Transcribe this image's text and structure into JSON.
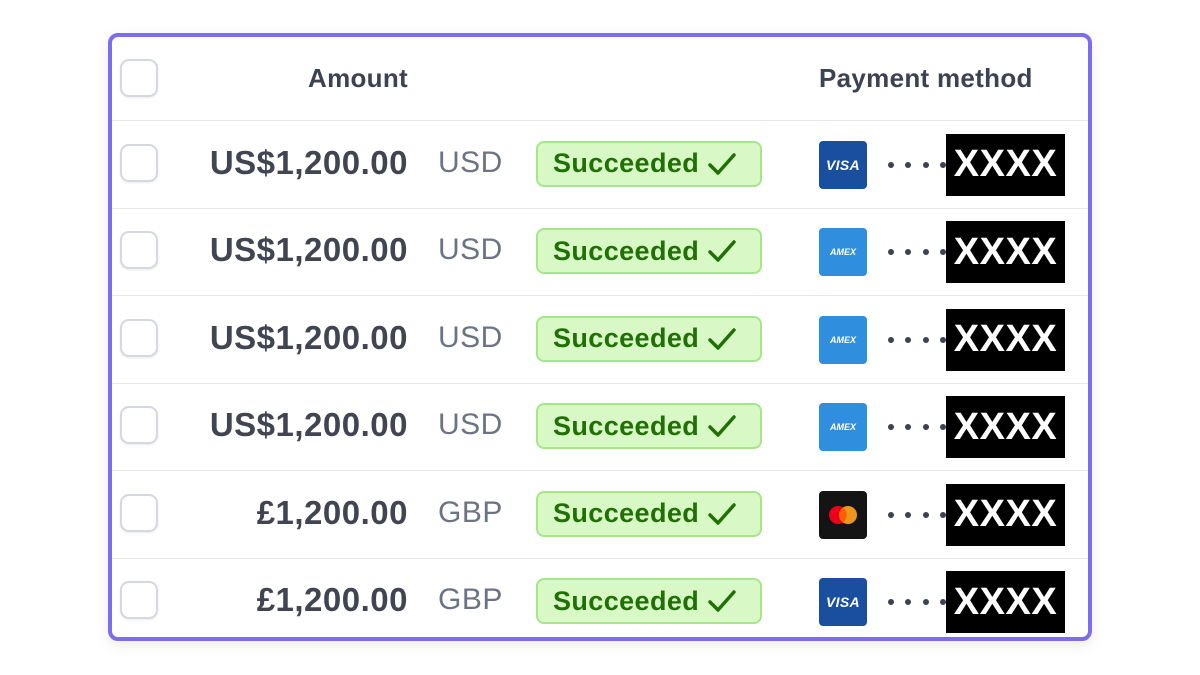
{
  "table": {
    "headers": {
      "amount": "Amount",
      "payment_method": "Payment method"
    },
    "rows": [
      {
        "amount": "US$1,200.00",
        "currency": "USD",
        "status": "Succeeded",
        "card_brand": "visa",
        "card_label": "VISA",
        "masked_prefix": "••••",
        "last4": "XXXX"
      },
      {
        "amount": "US$1,200.00",
        "currency": "USD",
        "status": "Succeeded",
        "card_brand": "amex",
        "card_label": "AMEX",
        "masked_prefix": "••••",
        "last4": "XXXX"
      },
      {
        "amount": "US$1,200.00",
        "currency": "USD",
        "status": "Succeeded",
        "card_brand": "amex",
        "card_label": "AMEX",
        "masked_prefix": "••••",
        "last4": "XXXX"
      },
      {
        "amount": "US$1,200.00",
        "currency": "USD",
        "status": "Succeeded",
        "card_brand": "amex",
        "card_label": "AMEX",
        "masked_prefix": "••••",
        "last4": "XXXX"
      },
      {
        "amount": "£1,200.00",
        "currency": "GBP",
        "status": "Succeeded",
        "card_brand": "mastercard",
        "card_label": "",
        "masked_prefix": "••••",
        "last4": "XXXX"
      },
      {
        "amount": "£1,200.00",
        "currency": "GBP",
        "status": "Succeeded",
        "card_brand": "visa",
        "card_label": "VISA",
        "masked_prefix": "••••",
        "last4": "XXXX"
      }
    ]
  },
  "icons": {
    "status_check": "checkmark-icon",
    "select_all": "checkbox-icon"
  },
  "colors": {
    "panel_border": "#7b6cf0",
    "badge_bg": "#d8f8c6",
    "badge_border": "#a6e68a",
    "badge_text": "#217005",
    "visa_bg": "#1a4fa0",
    "amex_bg": "#2f8fde",
    "mastercard_bg": "#141414"
  }
}
